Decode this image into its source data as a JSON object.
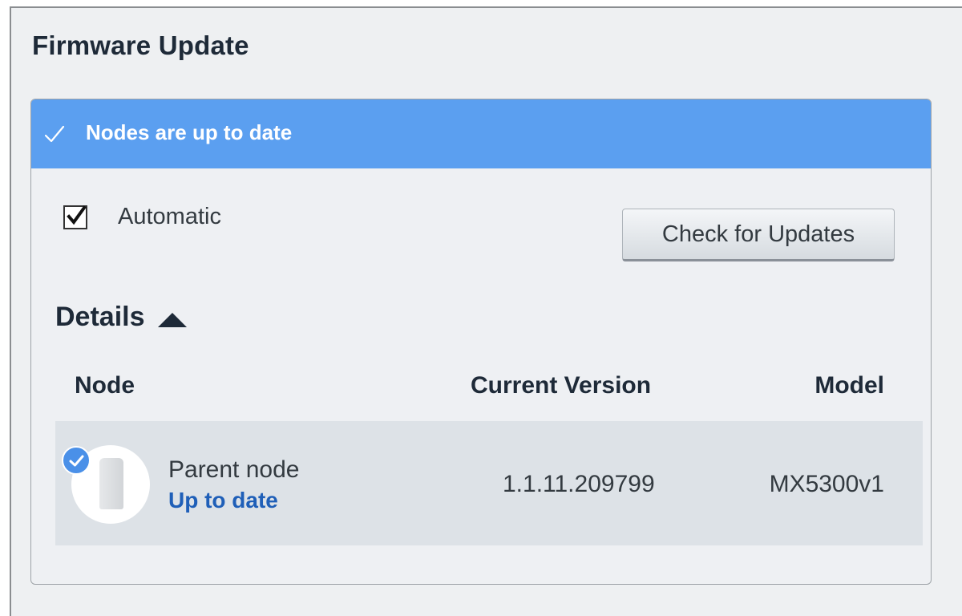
{
  "page": {
    "title": "Firmware Update"
  },
  "banner": {
    "text": "Nodes are up to date",
    "color": "#5b9ff0",
    "icon": "checkmark-icon"
  },
  "automatic": {
    "label": "Automatic",
    "checked": true
  },
  "check_button": {
    "label": "Check for Updates"
  },
  "details": {
    "label": "Details",
    "expanded": true,
    "icon": "caret-up-icon"
  },
  "table": {
    "headers": {
      "node": "Node",
      "version": "Current Version",
      "model": "Model"
    },
    "rows": [
      {
        "name": "Parent node",
        "status": "Up to date",
        "version": "1.1.11.209799",
        "model": "MX5300v1",
        "icon": "router-node-icon",
        "badge_icon": "check-badge-icon"
      }
    ]
  },
  "colors": {
    "accent": "#5b9ff0",
    "link": "#1f5fb8",
    "row_background": "#dde2e7"
  }
}
